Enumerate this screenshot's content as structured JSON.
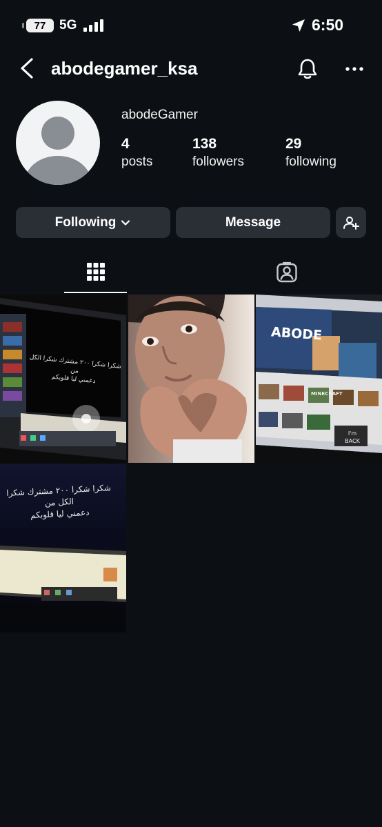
{
  "status_bar": {
    "battery": "77",
    "network": "5G",
    "time": "6:50"
  },
  "header": {
    "username": "abodegamer_ksa"
  },
  "profile": {
    "display_name": "abodeGamer",
    "stats": [
      {
        "value": "4",
        "label": "posts"
      },
      {
        "value": "138",
        "label": "followers"
      },
      {
        "value": "29",
        "label": "following"
      }
    ]
  },
  "actions": {
    "following_label": "Following",
    "message_label": "Message"
  },
  "tabs": {
    "active": "grid"
  },
  "posts": [
    {
      "caption_line1": "شكرا شكرا ٢٠٠ مشترك شكرا الكل من",
      "caption_line2": "دعمني ليا قلوبكم"
    },
    {},
    {
      "banner": "ABODE",
      "tile_text": "MINECRAFT",
      "back_line1": "I'm",
      "back_line2": "BACK"
    },
    {
      "caption_line1": "شكرا شكرا ٢٠٠ مشترك شكرا الكل من",
      "caption_line2": "دعمني ليا قلوبكم"
    }
  ],
  "colors": {
    "background": "#0c1014",
    "button": "#2a2f35",
    "text": "#f5f5f5"
  }
}
